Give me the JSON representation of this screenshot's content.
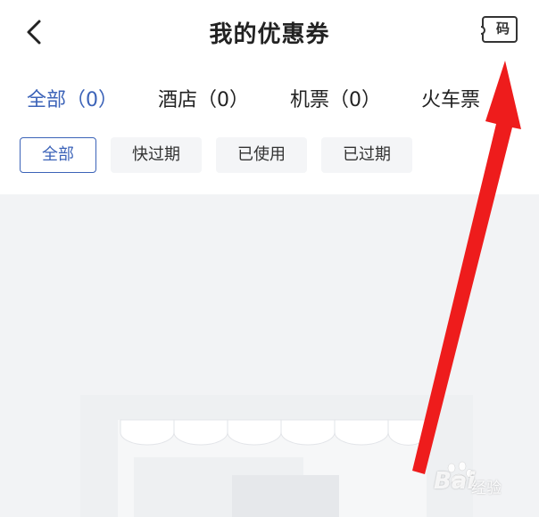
{
  "header": {
    "title": "我的优惠券",
    "code_button_label": "码"
  },
  "tabs": [
    {
      "label": "全部（0）",
      "active": true
    },
    {
      "label": "酒店（0）",
      "active": false
    },
    {
      "label": "机票（0）",
      "active": false
    },
    {
      "label": "火车票（",
      "active": false
    }
  ],
  "filters": [
    {
      "label": "全部",
      "active": true
    },
    {
      "label": "快过期",
      "active": false
    },
    {
      "label": "已使用",
      "active": false
    },
    {
      "label": "已过期",
      "active": false
    }
  ],
  "colors": {
    "accent": "#3c63b8",
    "annotation_arrow": "#ee1c1c",
    "content_background": "#f2f3f5"
  },
  "icons": {
    "back": "chevron-left-icon",
    "coupon_code": "ticket-code-icon",
    "empty_state": "storefront-awning-illustration",
    "annotation": "red-arrow-annotation"
  },
  "watermark": {
    "brand": "Bai",
    "sub": "经验"
  }
}
